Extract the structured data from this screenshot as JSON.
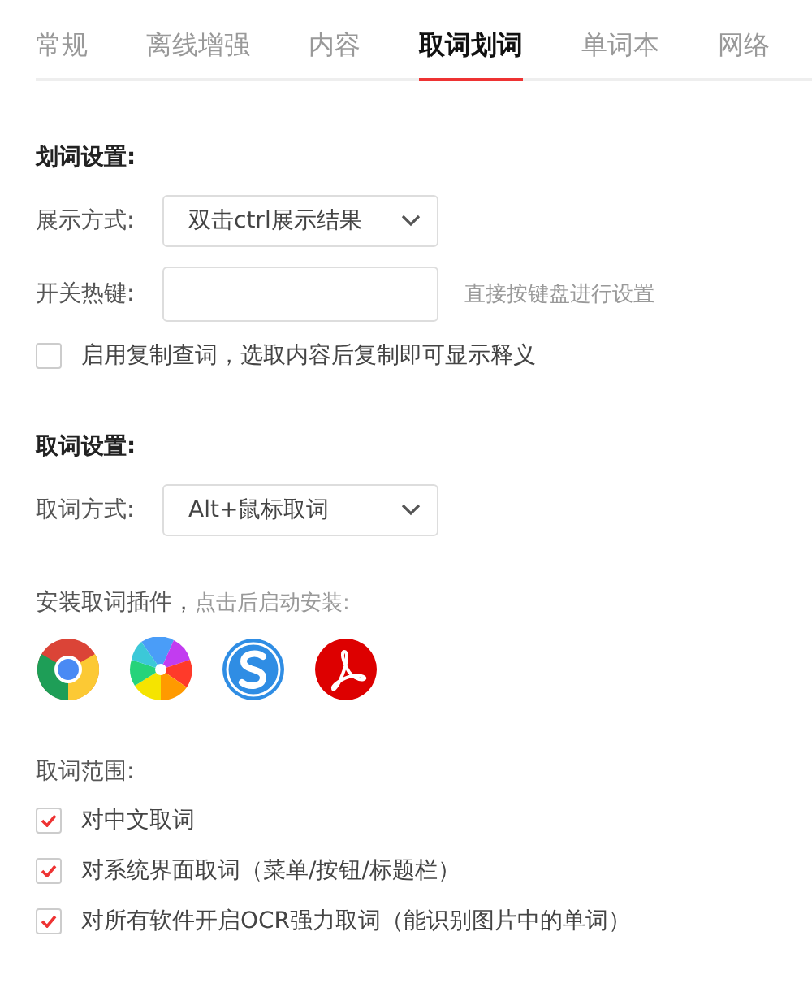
{
  "tabs": [
    {
      "label": "常规",
      "selected": false
    },
    {
      "label": "离线增强",
      "selected": false
    },
    {
      "label": "内容",
      "selected": false
    },
    {
      "label": "取词划词",
      "selected": true
    },
    {
      "label": "单词本",
      "selected": false
    },
    {
      "label": "网络",
      "selected": false
    }
  ],
  "selection_settings": {
    "heading": "划词设置:",
    "display_label": "展示方式:",
    "display_value": "双击ctrl展示结果",
    "hotkey_label": "开关热键:",
    "hotkey_hint": "直接按键盘进行设置",
    "copy_lookup": {
      "label": "启用复制查词，选取内容后复制即可显示释义",
      "checked": false
    }
  },
  "capture_settings": {
    "heading": "取词设置:",
    "method_label": "取词方式:",
    "method_value": "Alt+鼠标取词"
  },
  "plugins": {
    "label": "安装取词插件，",
    "hint": "点击后启动安装:"
  },
  "scope": {
    "heading": "取词范围:",
    "options": [
      {
        "label": "对中文取词",
        "checked": true
      },
      {
        "label": "对系统界面取词（菜单/按钮/标题栏）",
        "checked": true
      },
      {
        "label": "对所有软件开启OCR强力取词（能识别图片中的单词）",
        "checked": true
      }
    ]
  }
}
